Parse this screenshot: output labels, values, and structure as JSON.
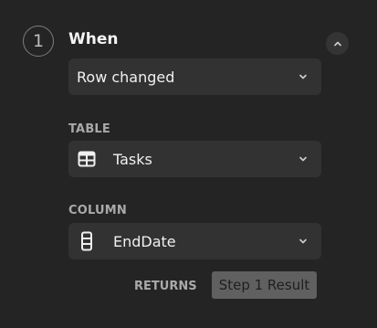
{
  "step": {
    "number": "1",
    "title": "When"
  },
  "trigger": {
    "value": "Row changed"
  },
  "table": {
    "label": "TABLE",
    "value": "Tasks",
    "icon": "table-icon"
  },
  "column": {
    "label": "COLUMN",
    "value": "EndDate",
    "icon": "column-icon"
  },
  "returns": {
    "label": "RETURNS",
    "value": "Step 1 Result"
  },
  "colors": {
    "background": "#242424",
    "field": "#323232",
    "chip": "#606060"
  }
}
